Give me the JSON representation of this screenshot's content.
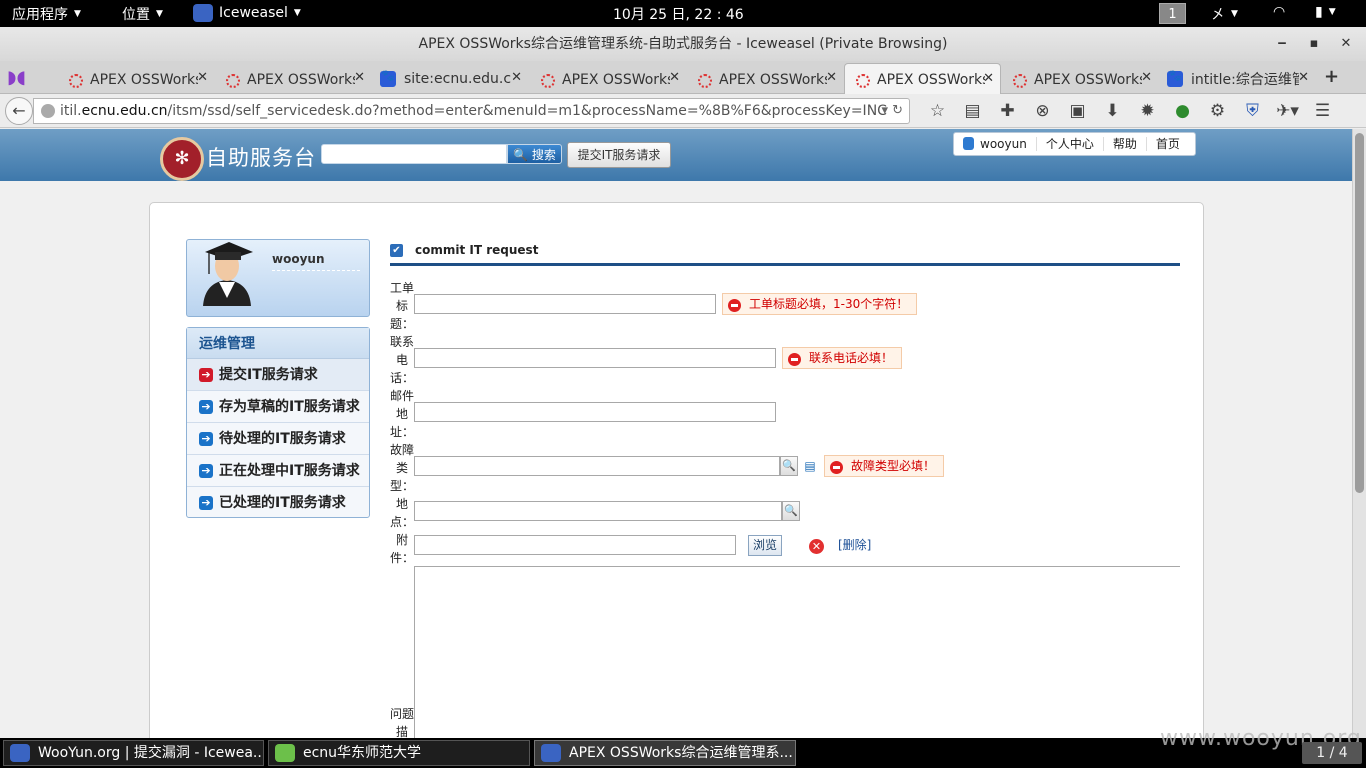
{
  "topbar": {
    "apps": "应用程序",
    "places": "位置",
    "browser": "Iceweasel",
    "clock": "10月 25 日, 22 : 46",
    "workspace": "1",
    "input_method": "㐅"
  },
  "window": {
    "title": "APEX OSSWorks综合运维管理系统-自助式服务台 - Iceweasel (Private Browsing)"
  },
  "tabs": [
    {
      "label": "APEX OSSWorks综合运维管理系统",
      "icon": "spinner-dots"
    },
    {
      "label": "APEX OSSWorks综合运维管理系统",
      "icon": "spinner-dots"
    },
    {
      "label": "site:ecnu.edu.cn",
      "icon": "baidu-paw"
    },
    {
      "label": "APEX OSSWorks综合运维管理系统",
      "icon": "spinner-dots"
    },
    {
      "label": "APEX OSSWorks综合运维管理系统",
      "icon": "spinner-dots"
    },
    {
      "label": "APEX OSSWorks综合运维管理系统",
      "icon": "spinner-dots",
      "active": true
    },
    {
      "label": "APEX OSSWorks综合运维管理系统",
      "icon": "spinner-dots"
    },
    {
      "label": "intitle:综合运维管理系统",
      "icon": "baidu-paw"
    }
  ],
  "url": {
    "prefix": "itil.",
    "host": "ecnu.edu.cn",
    "path": "/itsm/ssd/self_servicedesk.do?method=enter&menuId=m1&processName=%8B%F6&processKey=INC"
  },
  "site": {
    "name": "自助服务台",
    "search_button": "搜索",
    "submit_button": "提交IT服务请求",
    "links": [
      "wooyun",
      "个人中心",
      "帮助",
      "首页"
    ]
  },
  "user": {
    "name": "wooyun"
  },
  "menu": {
    "header": "运维管理",
    "items": [
      {
        "label": "提交IT服务请求",
        "active": true
      },
      {
        "label": "存为草稿的IT服务请求"
      },
      {
        "label": "待处理的IT服务请求"
      },
      {
        "label": "正在处理中IT服务请求"
      },
      {
        "label": "已处理的IT服务请求"
      }
    ]
  },
  "form": {
    "title": "commit IT request",
    "fields": {
      "ticket_title": {
        "label": "工单标题：",
        "error": "工单标题必填，1-30个字符！"
      },
      "phone": {
        "label": "联系电话：",
        "error": "联系电话必填！"
      },
      "email": {
        "label": "邮件地址："
      },
      "fault_type": {
        "label": "故障类型：",
        "error": "故障类型必填！"
      },
      "location": {
        "label": "地点："
      },
      "attachment": {
        "label": "附件：",
        "browse": "浏览",
        "delete": "[删除]"
      },
      "description": {
        "label": "问题描"
      }
    }
  },
  "taskbar": [
    {
      "label": "WooYun.org | 提交漏洞 - Icewea...",
      "icon": "iceweasel"
    },
    {
      "label": "ecnu华东师范大学",
      "icon": "text-editor"
    },
    {
      "label": "APEX OSSWorks综合运维管理系...",
      "icon": "iceweasel",
      "active": true
    }
  ],
  "pager": "1 / 4",
  "watermark": "www.wooyun.org"
}
